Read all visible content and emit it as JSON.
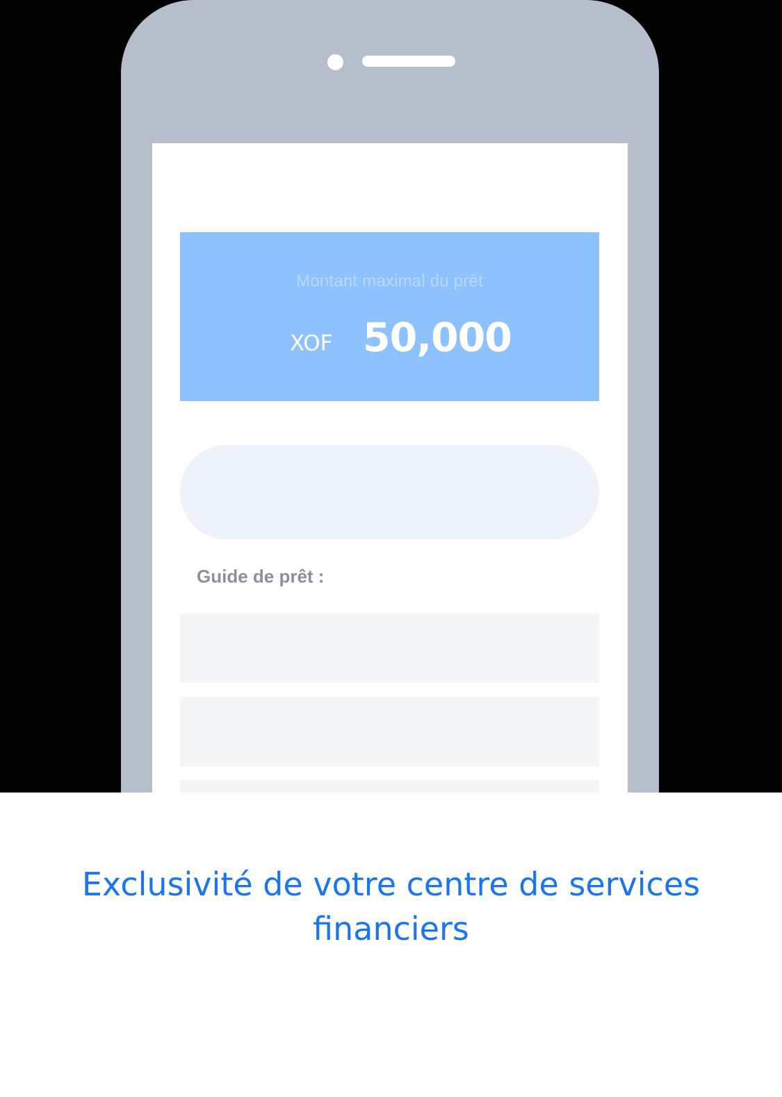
{
  "loan_card": {
    "title": "Montant maximal du prêt",
    "currency": "XOF",
    "amount": "50,000"
  },
  "guide": {
    "title": "Guide de prêt :"
  },
  "caption": {
    "text": "Exclusivité de votre centre de services financiers"
  },
  "colors": {
    "phone_frame": "#b6bdcb",
    "card_background": "#8ec2ff",
    "caption_text": "#1a75f2",
    "guide_title": "#8a909c"
  }
}
